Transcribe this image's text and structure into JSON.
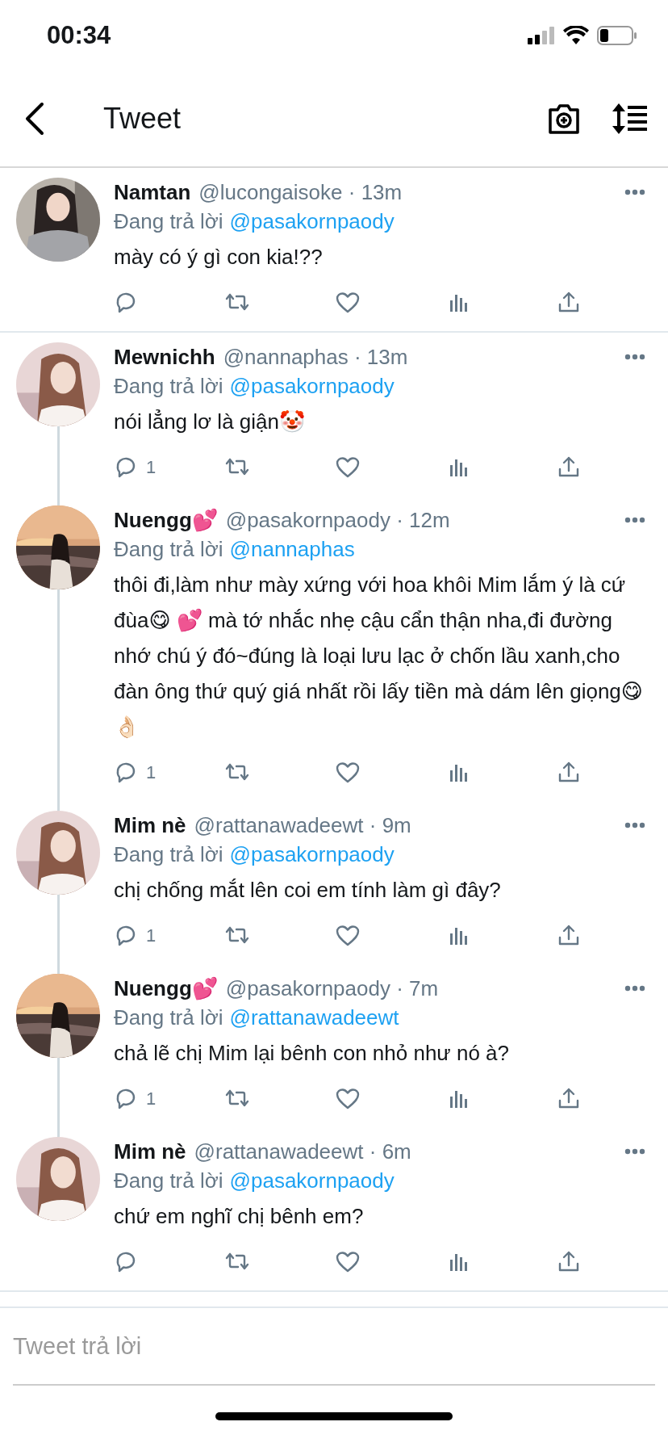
{
  "status_bar": {
    "time": "00:34"
  },
  "header": {
    "title": "Tweet"
  },
  "tweets": [
    {
      "name": "Namtan",
      "handle_time": "@lucongaisoke · 13m",
      "reply_label": "Đang trả lời",
      "reply_to": "@pasakornpaody",
      "text": "mày có ý gì con kia!??",
      "thread_up": false,
      "thread_down": false
    },
    {
      "name": "Mewnichh",
      "handle_time": "@nannaphas · 13m",
      "reply_label": "Đang trả lời",
      "reply_to": "@pasakornpaody",
      "text": "nói lẳng lơ là giận🤡",
      "reply_count": "1",
      "thread_up": false,
      "thread_down": true
    },
    {
      "name": "Nuengg💕",
      "handle_time": "@pasakornpaody · 12m",
      "reply_label": "Đang trả lời",
      "reply_to": "@nannaphas",
      "text": "thôi đi,làm như mày xứng với hoa khôi Mim lắm ý là cứ đùa😋 💕  mà tớ nhắc nhẹ cậu cẩn thận nha,đi đường nhớ chú ý đó~đúng là loại lưu lạc ở chốn lầu xanh,cho đàn ông thứ quý giá nhất rồi lấy tiền mà dám lên giọng😋 👌🏻",
      "reply_count": "1",
      "thread_up": true,
      "thread_down": true
    },
    {
      "name": "Mim nè",
      "handle_time": "@rattanawadeewt · 9m",
      "reply_label": "Đang trả lời",
      "reply_to": "@pasakornpaody",
      "text": "chị chống mắt lên coi em tính làm gì đây?",
      "reply_count": "1",
      "thread_up": true,
      "thread_down": true
    },
    {
      "name": "Nuengg💕",
      "handle_time": "@pasakornpaody · 7m",
      "reply_label": "Đang trả lời",
      "reply_to": "@rattanawadeewt",
      "text": "chả lẽ chị Mim lại bênh con nhỏ như nó à?",
      "reply_count": "1",
      "thread_up": true,
      "thread_down": true
    },
    {
      "name": "Mim nè",
      "handle_time": "@rattanawadeewt · 6m",
      "reply_label": "Đang trả lời",
      "reply_to": "@pasakornpaody",
      "text": "chứ em nghĩ chị bênh em?",
      "thread_up": true,
      "thread_down": false
    }
  ],
  "reply_field": {
    "placeholder": "Tweet trả lời"
  }
}
